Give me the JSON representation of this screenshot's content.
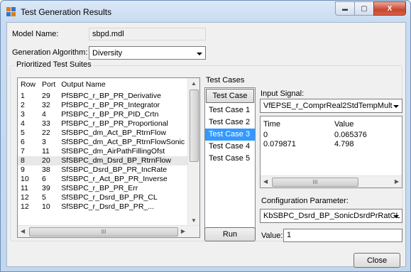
{
  "window": {
    "title": "Test Generation Results",
    "min_glyph": "▬",
    "max_glyph": "▢",
    "close_glyph": "X"
  },
  "model": {
    "label": "Model Name:",
    "value": "sbpd.mdl"
  },
  "algorithm": {
    "label": "Generation Algorithm:",
    "value": "Diversity"
  },
  "suites": {
    "group_label": "Prioritized Test Suites",
    "columns": [
      "Row",
      "Port",
      "Output Name"
    ],
    "rows": [
      [
        "1",
        "29",
        "PfSBPC_r_BP_PR_Derivative"
      ],
      [
        "2",
        "32",
        "PfSBPC_r_BP_PR_Integrator"
      ],
      [
        "3",
        "4",
        "PfSBPC_r_BP_PR_PID_Crtn"
      ],
      [
        "4",
        "33",
        "PfSBPC_r_BP_PR_Proportional"
      ],
      [
        "5",
        "22",
        "SfSBPC_dm_Act_BP_RtrnFlow"
      ],
      [
        "6",
        "3",
        "SfSBPC_dm_Act_BP_RtrnFlowSonic"
      ],
      [
        "7",
        "11",
        "SfSBPC_dm_AirPathFillingOfst"
      ],
      [
        "8",
        "20",
        "SfSBPC_dm_Dsrd_BP_RtrnFlow"
      ],
      [
        "9",
        "38",
        "SfSBPC_Dsrd_BP_PR_IncRate"
      ],
      [
        "10",
        "6",
        "SfSBPC_r_Act_BP_PR_Inverse"
      ],
      [
        "11",
        "39",
        "SfSBPC_r_BP_PR_Err"
      ],
      [
        "12",
        "5",
        "SfSBPC_r_Dsrd_BP_PR_CL"
      ],
      [
        "12",
        "10",
        "SfSBPC_r_Dsrd_BP_PR_..."
      ]
    ],
    "hscroll_mid": "III"
  },
  "test_cases": {
    "group_label": "Test Cases",
    "header": "Test Case",
    "items": [
      "Test Case 1",
      "Test Case 2",
      "Test Case 3",
      "Test Case 4",
      "Test Case 5"
    ],
    "selected": 2,
    "run_label": "Run"
  },
  "signal": {
    "label": "Input Signal:",
    "value": "VfEPSE_r_ComprReal2StdTempMult",
    "columns": [
      "Time",
      "Value"
    ],
    "rows": [
      [
        "0",
        "0.065376"
      ],
      [
        "0.079871",
        "4.798"
      ]
    ],
    "hscroll_mid": "III"
  },
  "config": {
    "label": "Configuration Parameter:",
    "value": "KbSBPC_Dsrd_BP_SonicDsrdPrRatCL",
    "value_label": "Value:",
    "value_input": "1"
  },
  "footer": {
    "close_label": "Close"
  },
  "colors": {
    "selection": "#3399ff",
    "title_bg": "#c9dbf1"
  }
}
